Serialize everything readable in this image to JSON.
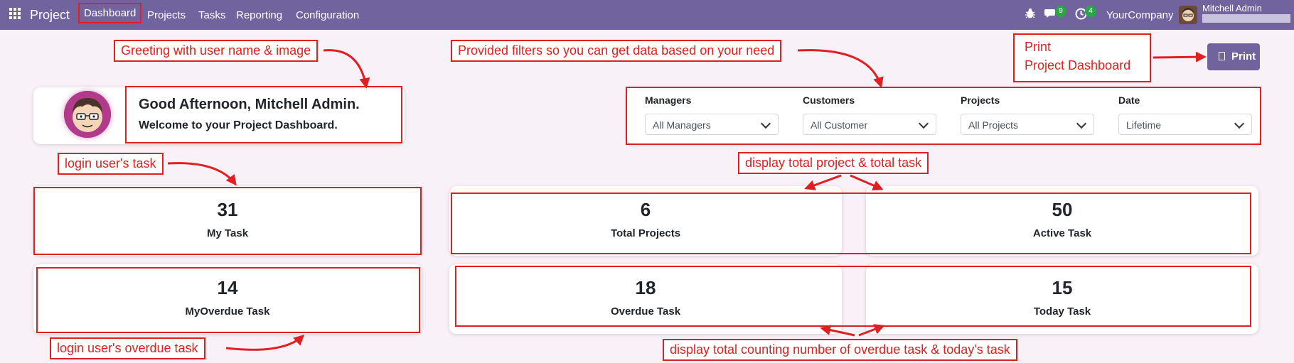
{
  "topbar": {
    "brand": "Project",
    "menu": [
      "Dashboard",
      "Projects",
      "Tasks",
      "Reporting",
      "Configuration"
    ],
    "messages_count": "9",
    "activities_count": "4",
    "company": "YourCompany",
    "user_name": "Mitchell Admin"
  },
  "greeting": {
    "title": "Good Afternoon, Mitchell Admin.",
    "subtitle": "Welcome to your Project Dashboard."
  },
  "filters": [
    {
      "label": "Managers",
      "value": "All Managers"
    },
    {
      "label": "Customers",
      "value": "All Customer"
    },
    {
      "label": "Projects",
      "value": "All Projects"
    },
    {
      "label": "Date",
      "value": "Lifetime"
    }
  ],
  "print_button": "Print",
  "stats": {
    "my_task": {
      "value": "31",
      "label": "My Task"
    },
    "my_overdue": {
      "value": "14",
      "label": "MyOverdue Task"
    },
    "total_projects": {
      "value": "6",
      "label": "Total Projects"
    },
    "active_task": {
      "value": "50",
      "label": "Active Task"
    },
    "overdue_task": {
      "value": "18",
      "label": "Overdue Task"
    },
    "today_task": {
      "value": "15",
      "label": "Today Task"
    }
  },
  "annotations": {
    "greeting": "Greeting with user name & image",
    "filters": "Provided filters so you can get data based on your need",
    "print_line1": "Print",
    "print_line2": "Project Dashboard",
    "login_task": "login user's task",
    "total_counts": "display total project & total task",
    "login_overdue": "login user's overdue task",
    "overdue_today": "display total counting number of overdue task & today's task"
  },
  "colors": {
    "primary": "#71639e",
    "background": "#f9f1f8",
    "annotation": "#e02020",
    "badge": "#28a745"
  },
  "icons": [
    "apps-grid-icon",
    "bug-icon",
    "chat-icon",
    "clock-icon",
    "print-icon",
    "chevron-down-icon"
  ]
}
